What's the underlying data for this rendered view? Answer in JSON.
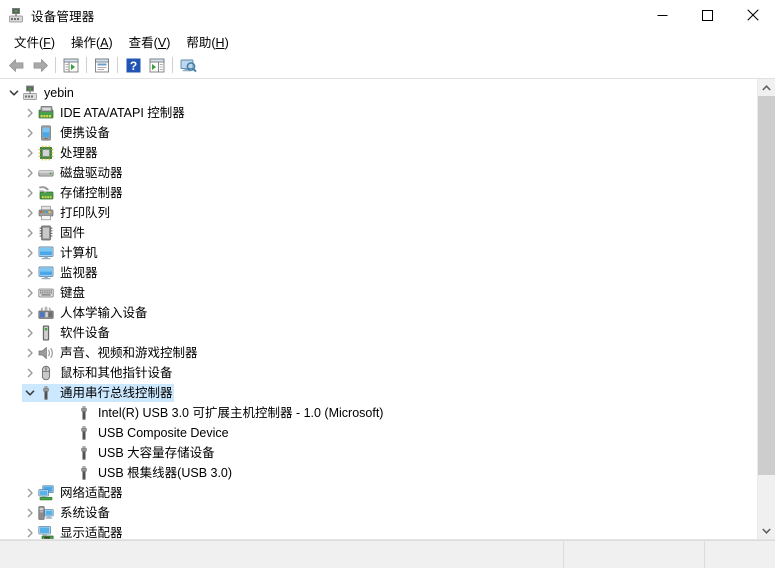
{
  "window": {
    "title": "设备管理器",
    "icon": "device-manager-icon",
    "controls": {
      "minimize": "—",
      "maximize": "□",
      "close": "✕"
    }
  },
  "menubar": {
    "items": [
      {
        "label": "文件(F)",
        "text": "文件(",
        "mnemonic": "F",
        "tail": ")"
      },
      {
        "label": "操作(A)",
        "text": "操作(",
        "mnemonic": "A",
        "tail": ")"
      },
      {
        "label": "查看(V)",
        "text": "查看(",
        "mnemonic": "V",
        "tail": ")"
      },
      {
        "label": "帮助(H)",
        "text": "帮助(",
        "mnemonic": "H",
        "tail": ")"
      }
    ]
  },
  "toolbar": {
    "buttons": [
      {
        "name": "back-button",
        "icon": "back-arrow-icon"
      },
      {
        "name": "forward-button",
        "icon": "forward-arrow-icon"
      },
      {
        "name": "show-hide-console-tree-button",
        "icon": "console-tree-icon"
      },
      {
        "name": "properties-button",
        "icon": "properties-window-icon"
      },
      {
        "name": "help-button",
        "icon": "question-mark-icon"
      },
      {
        "name": "update-driver-button",
        "icon": "scan-window-icon"
      },
      {
        "name": "scan-hardware-changes-button",
        "icon": "monitor-scan-icon"
      }
    ]
  },
  "tree": {
    "root": {
      "label": "yebin",
      "icon": "computer-node-icon",
      "expanded": true,
      "level": 0
    },
    "nodes": [
      {
        "label": "IDE ATA/ATAPI 控制器",
        "icon": "ide-controller-icon",
        "expanded": false,
        "level": 1,
        "selected": false
      },
      {
        "label": "便携设备",
        "icon": "portable-device-icon",
        "expanded": false,
        "level": 1,
        "selected": false
      },
      {
        "label": "处理器",
        "icon": "processor-icon",
        "expanded": false,
        "level": 1,
        "selected": false
      },
      {
        "label": "磁盘驱动器",
        "icon": "disk-drive-icon",
        "expanded": false,
        "level": 1,
        "selected": false
      },
      {
        "label": "存储控制器",
        "icon": "storage-controller-icon",
        "expanded": false,
        "level": 1,
        "selected": false
      },
      {
        "label": "打印队列",
        "icon": "print-queue-icon",
        "expanded": false,
        "level": 1,
        "selected": false
      },
      {
        "label": "固件",
        "icon": "firmware-icon",
        "expanded": false,
        "level": 1,
        "selected": false
      },
      {
        "label": "计算机",
        "icon": "computer-icon",
        "expanded": false,
        "level": 1,
        "selected": false
      },
      {
        "label": "监视器",
        "icon": "monitor-icon",
        "expanded": false,
        "level": 1,
        "selected": false
      },
      {
        "label": "键盘",
        "icon": "keyboard-icon",
        "expanded": false,
        "level": 1,
        "selected": false
      },
      {
        "label": "人体学输入设备",
        "icon": "hid-device-icon",
        "expanded": false,
        "level": 1,
        "selected": false
      },
      {
        "label": "软件设备",
        "icon": "software-device-icon",
        "expanded": false,
        "level": 1,
        "selected": false
      },
      {
        "label": "声音、视频和游戏控制器",
        "icon": "sound-video-game-icon",
        "expanded": false,
        "level": 1,
        "selected": false
      },
      {
        "label": "鼠标和其他指针设备",
        "icon": "mouse-icon",
        "expanded": false,
        "level": 1,
        "selected": false
      },
      {
        "label": "通用串行总线控制器",
        "icon": "usb-icon",
        "expanded": true,
        "level": 1,
        "selected": true
      },
      {
        "label": "Intel(R) USB 3.0 可扩展主机控制器 - 1.0 (Microsoft)",
        "icon": "usb-icon",
        "expanded": null,
        "level": 2,
        "selected": false
      },
      {
        "label": "USB Composite Device",
        "icon": "usb-icon",
        "expanded": null,
        "level": 2,
        "selected": false
      },
      {
        "label": "USB 大容量存储设备",
        "icon": "usb-icon",
        "expanded": null,
        "level": 2,
        "selected": false
      },
      {
        "label": "USB 根集线器(USB 3.0)",
        "icon": "usb-icon",
        "expanded": null,
        "level": 2,
        "selected": false
      },
      {
        "label": "网络适配器",
        "icon": "network-adapter-icon",
        "expanded": false,
        "level": 1,
        "selected": false
      },
      {
        "label": "系统设备",
        "icon": "system-device-icon",
        "expanded": false,
        "level": 1,
        "selected": false
      },
      {
        "label": "显示适配器",
        "icon": "display-adapter-icon",
        "expanded": false,
        "level": 1,
        "selected": false
      }
    ]
  },
  "scrollbar": {
    "up_arrow": "▲",
    "down_arrow": "▼",
    "thumb_position_percent": 0
  },
  "statusbar": {
    "pane1": "",
    "pane2": "",
    "pane3": ""
  },
  "colors": {
    "selection": "#cce8ff",
    "window_bg": "#ffffff",
    "statusbar_bg": "#f0f0f0",
    "scrollbar_thumb": "#cdcdcd"
  }
}
